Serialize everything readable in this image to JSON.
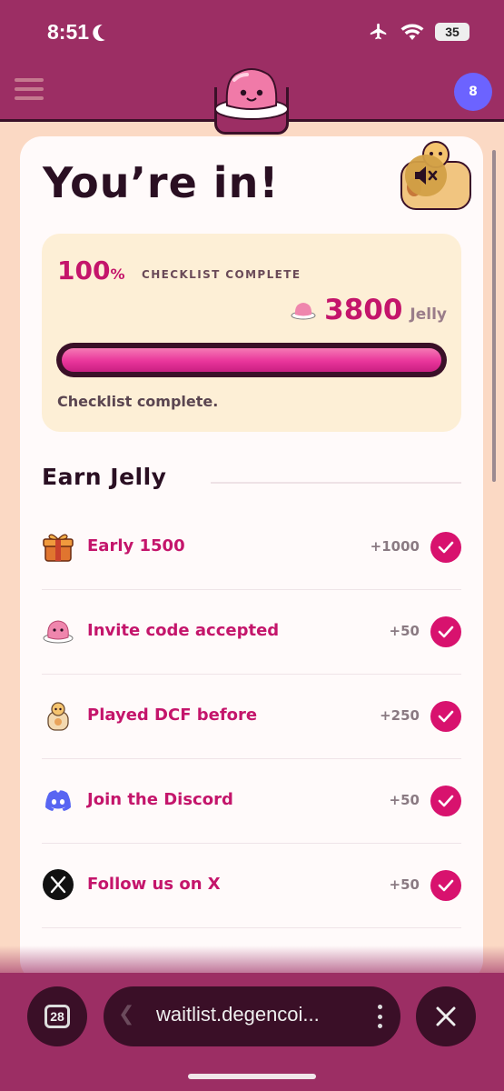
{
  "status_bar": {
    "time": "8:51",
    "battery": "35"
  },
  "header": {
    "notification_count": "8"
  },
  "page": {
    "title": "You’re in!"
  },
  "checklist": {
    "percent": "100",
    "percent_sign": "%",
    "label": "CHECKLIST COMPLETE",
    "jelly_total": "3800",
    "jelly_unit": "Jelly",
    "progress": 1.0,
    "status_text": "Checklist complete."
  },
  "earn": {
    "title": "Earn Jelly",
    "tasks": [
      {
        "label": "Early 1500",
        "points": "+1000",
        "icon": "gift-icon",
        "completed": true
      },
      {
        "label": "Invite code accepted",
        "points": "+50",
        "icon": "jelly-icon",
        "completed": true
      },
      {
        "label": "Played DCF before",
        "points": "+250",
        "icon": "cat-icon",
        "completed": true
      },
      {
        "label": "Join the Discord",
        "points": "+50",
        "icon": "discord-icon",
        "completed": true
      },
      {
        "label": "Follow us on X",
        "points": "+50",
        "icon": "x-icon",
        "completed": true
      }
    ]
  },
  "browser": {
    "tab_count": "28",
    "url": "waitlist.degencoi..."
  },
  "colors": {
    "brand": "#9c2e64",
    "accent": "#c4156b",
    "check": "#d8126e",
    "panel": "#fdefd6"
  }
}
